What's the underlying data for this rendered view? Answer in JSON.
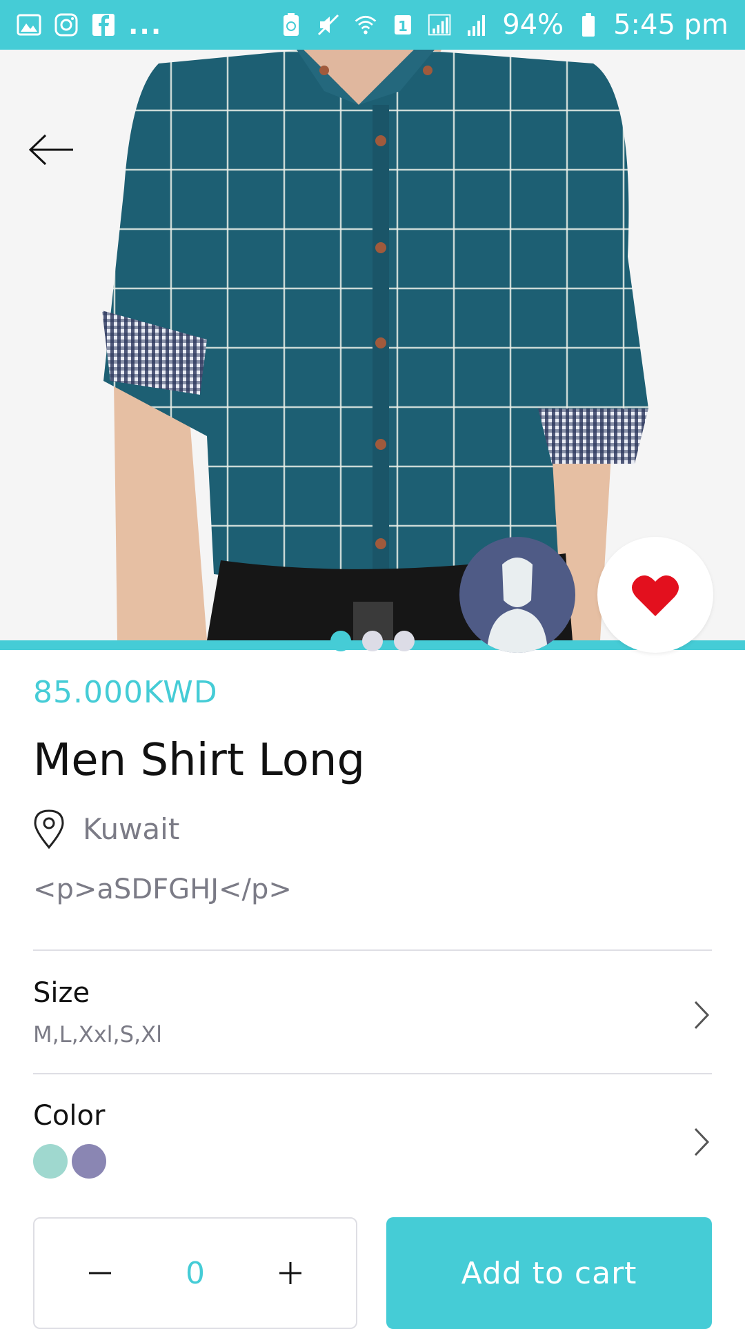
{
  "status_bar": {
    "left_icons": [
      "gallery-icon",
      "instagram-icon",
      "facebook-icon"
    ],
    "overflow": "...",
    "right_icons": [
      "battery-saver-icon",
      "mute-icon",
      "wifi-icon",
      "sim-icon",
      "signal-icon",
      "signal-icon"
    ],
    "battery": "94%",
    "time": "5:45 pm"
  },
  "hero": {
    "image_alt": "Men shirt product photo",
    "carousel": {
      "count": 3,
      "active_index": 0
    }
  },
  "product": {
    "price": "85.000KWD",
    "title": "Men Shirt Long",
    "location": "Kuwait",
    "description": "<p>aSDFGHJ</p>"
  },
  "options": {
    "size": {
      "label": "Size",
      "values": "M,L,Xxl,S,Xl"
    },
    "color": {
      "label": "Color",
      "swatches": [
        "#9fd8cf",
        "#8a86b3"
      ]
    }
  },
  "cart": {
    "quantity": "0",
    "add_label": "Add to cart"
  },
  "colors": {
    "accent": "#45ccd6",
    "favorite": "#e3101e",
    "avatar_bg": "#4f5b86"
  }
}
